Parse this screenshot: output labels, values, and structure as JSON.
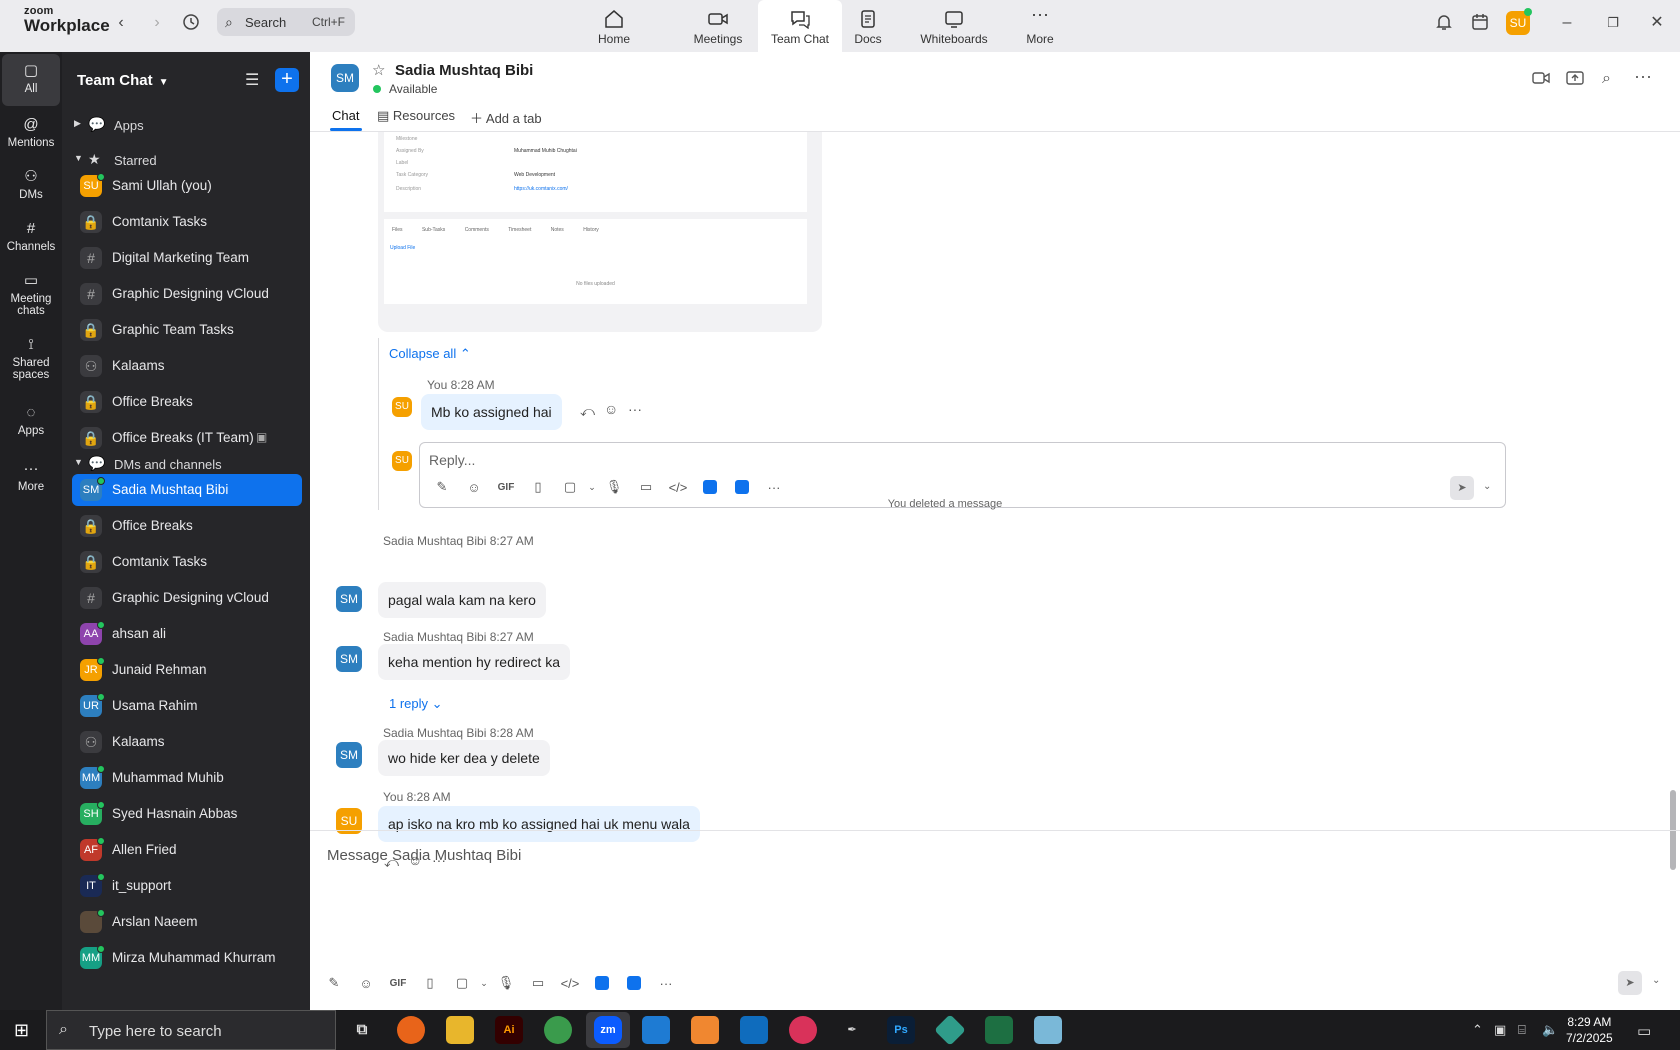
{
  "app": {
    "logo_line1": "zoom",
    "logo_line2": "Workplace"
  },
  "search": {
    "placeholder": "Search",
    "shortcut": "Ctrl+F"
  },
  "nav_tabs": [
    {
      "label": "Home",
      "icon": "home-icon"
    },
    {
      "label": "Meetings",
      "icon": "video-icon"
    },
    {
      "label": "Team Chat",
      "icon": "chat-icon"
    },
    {
      "label": "Docs",
      "icon": "doc-icon"
    },
    {
      "label": "Whiteboards",
      "icon": "whiteboard-icon"
    },
    {
      "label": "More",
      "icon": "more-icon"
    }
  ],
  "user": {
    "initials": "SU",
    "color": "#f5a000"
  },
  "rail": [
    {
      "label": "All",
      "icon": "chat-icon"
    },
    {
      "label": "Mentions",
      "icon": "at-icon"
    },
    {
      "label": "DMs",
      "icon": "people-icon"
    },
    {
      "label": "Channels",
      "icon": "hash-icon"
    },
    {
      "label": "Meeting chats",
      "icon": "calendar-icon"
    },
    {
      "label": "Shared spaces",
      "icon": "share-icon"
    },
    {
      "label": "Apps",
      "icon": "apps-icon"
    },
    {
      "label": "More",
      "icon": "more-icon"
    }
  ],
  "sidebar": {
    "title": "Team Chat",
    "sections": [
      {
        "label": "Apps"
      },
      {
        "label": "Starred"
      },
      {
        "label": "DMs and channels"
      }
    ],
    "starred": [
      {
        "label": "Sami Ullah (you)",
        "initials": "SU",
        "color": "#f5a000",
        "type": "dm"
      },
      {
        "label": "Comtanix Tasks",
        "type": "lock"
      },
      {
        "label": "Digital Marketing Team",
        "type": "hash"
      },
      {
        "label": "Graphic Designing vCloud",
        "type": "hash"
      },
      {
        "label": "Graphic Team Tasks",
        "type": "lock"
      },
      {
        "label": "Kalaams",
        "type": "group"
      },
      {
        "label": "Office Breaks",
        "type": "lock"
      },
      {
        "label": "Office Breaks (IT Team)",
        "type": "lock"
      }
    ],
    "dms": [
      {
        "label": "Sadia Mushtaq Bibi",
        "initials": "SM",
        "color": "#2d7fbf",
        "type": "dm"
      },
      {
        "label": "Office Breaks",
        "type": "lock"
      },
      {
        "label": "Comtanix Tasks",
        "type": "lock"
      },
      {
        "label": "Graphic Designing vCloud",
        "type": "hash"
      },
      {
        "label": "ahsan ali",
        "initials": "AA",
        "color": "#8e44ad",
        "type": "dm"
      },
      {
        "label": "Junaid Rehman",
        "initials": "JR",
        "color": "#f5a000",
        "type": "dm"
      },
      {
        "label": "Usama Rahim",
        "initials": "UR",
        "color": "#2d7fbf",
        "type": "dm"
      },
      {
        "label": "Kalaams",
        "type": "group"
      },
      {
        "label": "Muhammad Muhib",
        "initials": "MM",
        "color": "#2d7fbf",
        "type": "dm"
      },
      {
        "label": "Syed Hasnain Abbas",
        "initials": "SH",
        "color": "#27ae60",
        "type": "dm"
      },
      {
        "label": "Allen Fried",
        "initials": "AF",
        "color": "#c0392b",
        "type": "dm"
      },
      {
        "label": "it_support",
        "initials": "IT",
        "color": "#1a2a55",
        "type": "dm"
      },
      {
        "label": "Arslan Naeem",
        "initials": "",
        "color": "#5a4a3a",
        "type": "dm"
      },
      {
        "label": "Mirza Muhammad Khurram",
        "initials": "MM",
        "color": "#16a085",
        "type": "dm"
      }
    ]
  },
  "chat_header": {
    "initials": "SM",
    "name": "Sadia Mushtaq Bibi",
    "status": "Available",
    "tabs": [
      "Chat",
      "Resources",
      "Add a tab"
    ]
  },
  "thread": {
    "collapse_label": "Collapse all",
    "reply": {
      "meta": "You 8:28 AM",
      "text": "Mb ko assigned hai"
    },
    "reply_placeholder": "Reply..."
  },
  "preview": {
    "rows": [
      {
        "label": "Milestone",
        "value": ""
      },
      {
        "label": "Assigned By",
        "value": "Muhammad Muhib Chughtai"
      },
      {
        "label": "Label",
        "value": ""
      },
      {
        "label": "Task Category",
        "value": "Web Development"
      },
      {
        "label": "Description",
        "value": "https://uk.comtanix.com/"
      }
    ],
    "tabs": [
      "Files",
      "Sub-Tasks",
      "Comments",
      "Timesheet",
      "Notes",
      "History"
    ],
    "upload": "Upload File",
    "empty": "No files uploaded"
  },
  "system_note": "You deleted a message",
  "messages": [
    {
      "meta": "Sadia Mushtaq Bibi 8:27 AM",
      "text": "pagal wala kam na kero",
      "initials": "SM"
    },
    {
      "meta": "Sadia Mushtaq Bibi 8:27 AM",
      "text": "keha mention hy redirect ka",
      "initials": "SM"
    },
    {
      "meta": "Sadia Mushtaq Bibi 8:28 AM",
      "text": "wo hide ker dea y delete",
      "initials": "SM"
    },
    {
      "meta": "You 8:28 AM",
      "text": "ap isko na kro mb ko assigned hai uk menu wala",
      "initials": "SU"
    }
  ],
  "reply_count": "1 reply",
  "composer": {
    "placeholder": "Message Sadia Mushtaq Bibi"
  },
  "taskbar": {
    "search_placeholder": "Type here to search",
    "time": "8:29 AM",
    "date": "7/2/2025"
  }
}
